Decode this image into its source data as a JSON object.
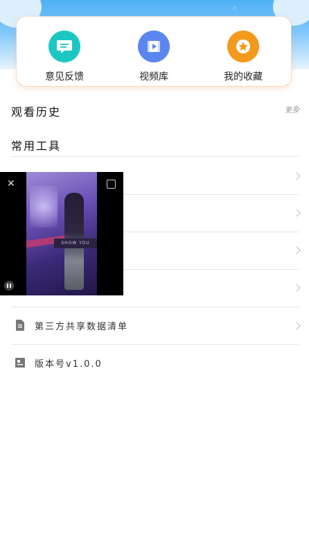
{
  "quick_actions": [
    {
      "label": "意见反馈",
      "icon": "feedback-icon",
      "color": "#1cc7c2"
    },
    {
      "label": "视频库",
      "icon": "video-library-icon",
      "color": "#5a86ef"
    },
    {
      "label": "我的收藏",
      "icon": "star-icon",
      "color": "#f39a1d"
    }
  ],
  "sections": {
    "history_title": "观看历史",
    "history_more": "更多",
    "tools_title": "常用工具"
  },
  "list": [
    {
      "label": "第三方共享数据清单",
      "icon": "document-icon"
    },
    {
      "label": "版本号v1.0.0",
      "icon": "version-card-icon"
    }
  ],
  "video": {
    "sign_text": "SHOW YOU"
  }
}
